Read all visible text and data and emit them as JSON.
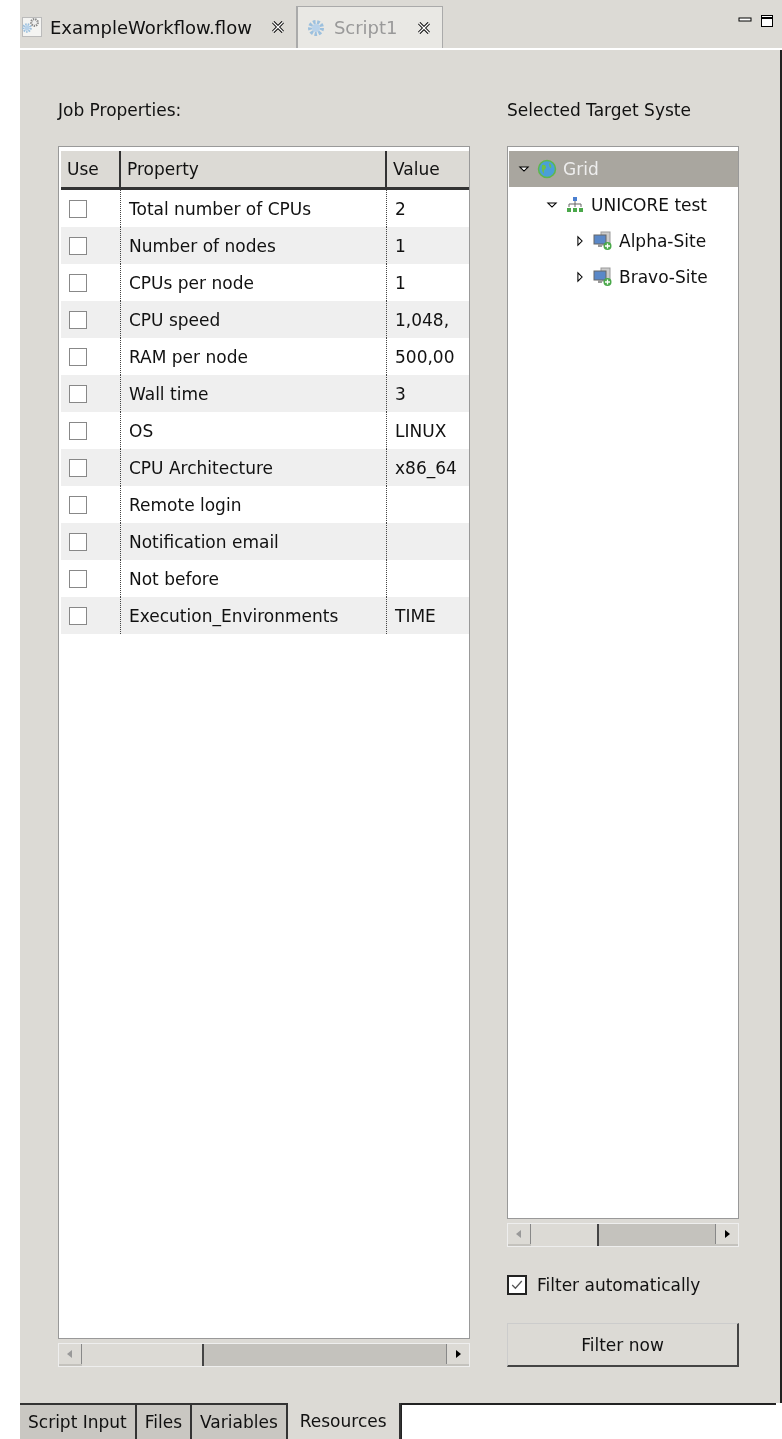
{
  "editor_tabs": [
    {
      "kind": "workflow",
      "label": "ExampleWorkflow.flow",
      "selected": false
    },
    {
      "kind": "script",
      "label": "Script1",
      "selected": true
    }
  ],
  "job_properties": {
    "title": "Job Properties:",
    "columns": [
      "Use",
      "Property",
      "Value"
    ],
    "rows": [
      {
        "checked": false,
        "property": "Total number of CPUs",
        "value": "2"
      },
      {
        "checked": false,
        "property": "Number of nodes",
        "value": "1"
      },
      {
        "checked": false,
        "property": "CPUs per node",
        "value": "1"
      },
      {
        "checked": false,
        "property": "CPU speed",
        "value": "1,048,"
      },
      {
        "checked": false,
        "property": "RAM per node",
        "value": "500,00"
      },
      {
        "checked": false,
        "property": "Wall time",
        "value": "3"
      },
      {
        "checked": false,
        "property": "OS",
        "value": "LINUX"
      },
      {
        "checked": false,
        "property": "CPU Architecture",
        "value": "x86_64"
      },
      {
        "checked": false,
        "property": "Remote login"
      },
      {
        "checked": false,
        "property": "Notification email"
      },
      {
        "checked": false,
        "property": "Not before"
      },
      {
        "checked": false,
        "property": "Execution_Environments",
        "value": "TIME"
      }
    ]
  },
  "target_systems": {
    "title": "Selected Target Syste",
    "tree": [
      {
        "kind": "grid",
        "label": "Grid",
        "expanded": true,
        "selected": true,
        "children": [
          {
            "kind": "group",
            "label": "UNICORE test",
            "expanded": true,
            "selected": false,
            "children": [
              {
                "kind": "site",
                "label": "Alpha-Site",
                "expanded": false,
                "selected": false
              },
              {
                "kind": "site",
                "label": "Bravo-Site",
                "expanded": false,
                "selected": false
              }
            ]
          }
        ]
      }
    ],
    "filter_automatically": {
      "label": "Filter automatically",
      "checked": true
    },
    "filter_button": "Filter now"
  },
  "bottom_tabs": [
    {
      "label": "Script Input",
      "selected": false
    },
    {
      "label": "Files",
      "selected": false
    },
    {
      "label": "Variables",
      "selected": false
    },
    {
      "label": "Resources",
      "selected": true
    }
  ]
}
